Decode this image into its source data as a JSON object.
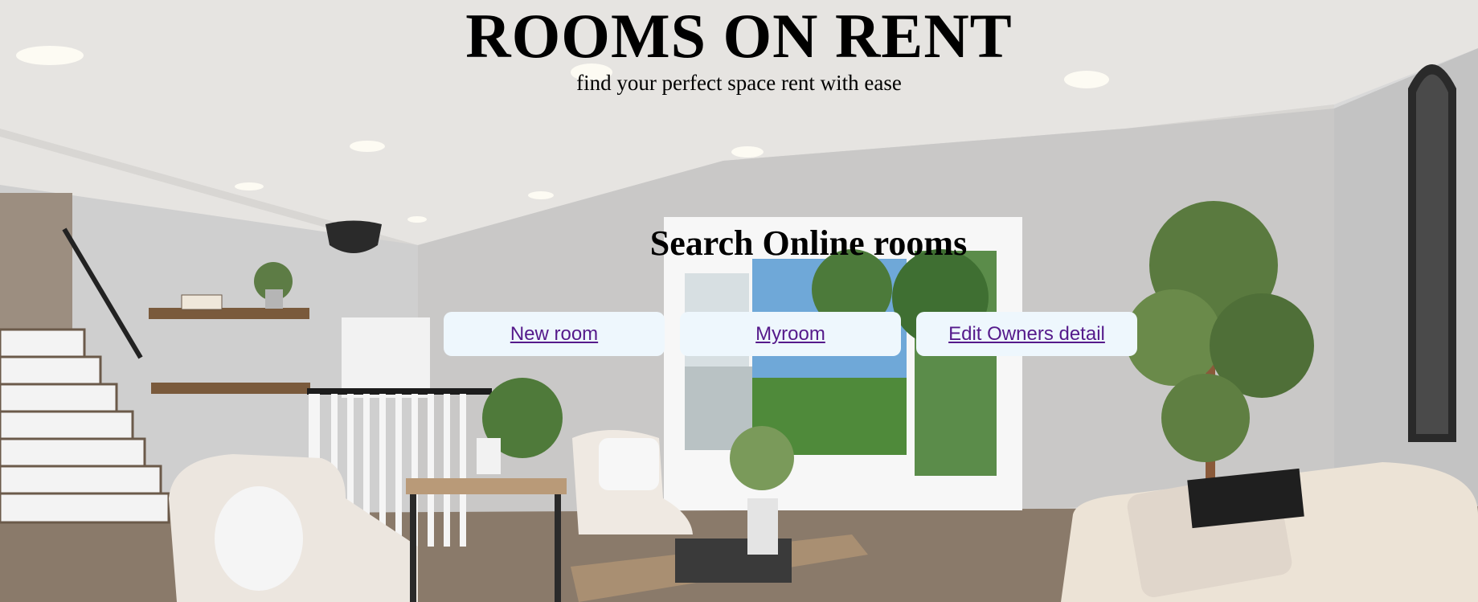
{
  "header": {
    "title": "ROOMS ON RENT",
    "tagline": "find your perfect space rent with ease"
  },
  "search": {
    "heading": "Search Online rooms"
  },
  "nav": {
    "items": [
      {
        "label": "New room"
      },
      {
        "label": "Myroom"
      },
      {
        "label": "Edit Owners detail"
      }
    ]
  },
  "theme": {
    "link_color": "#551a8b",
    "button_background": "#eef7fd",
    "text_color": "#000000"
  },
  "background": {
    "image": "living-room-photo"
  }
}
